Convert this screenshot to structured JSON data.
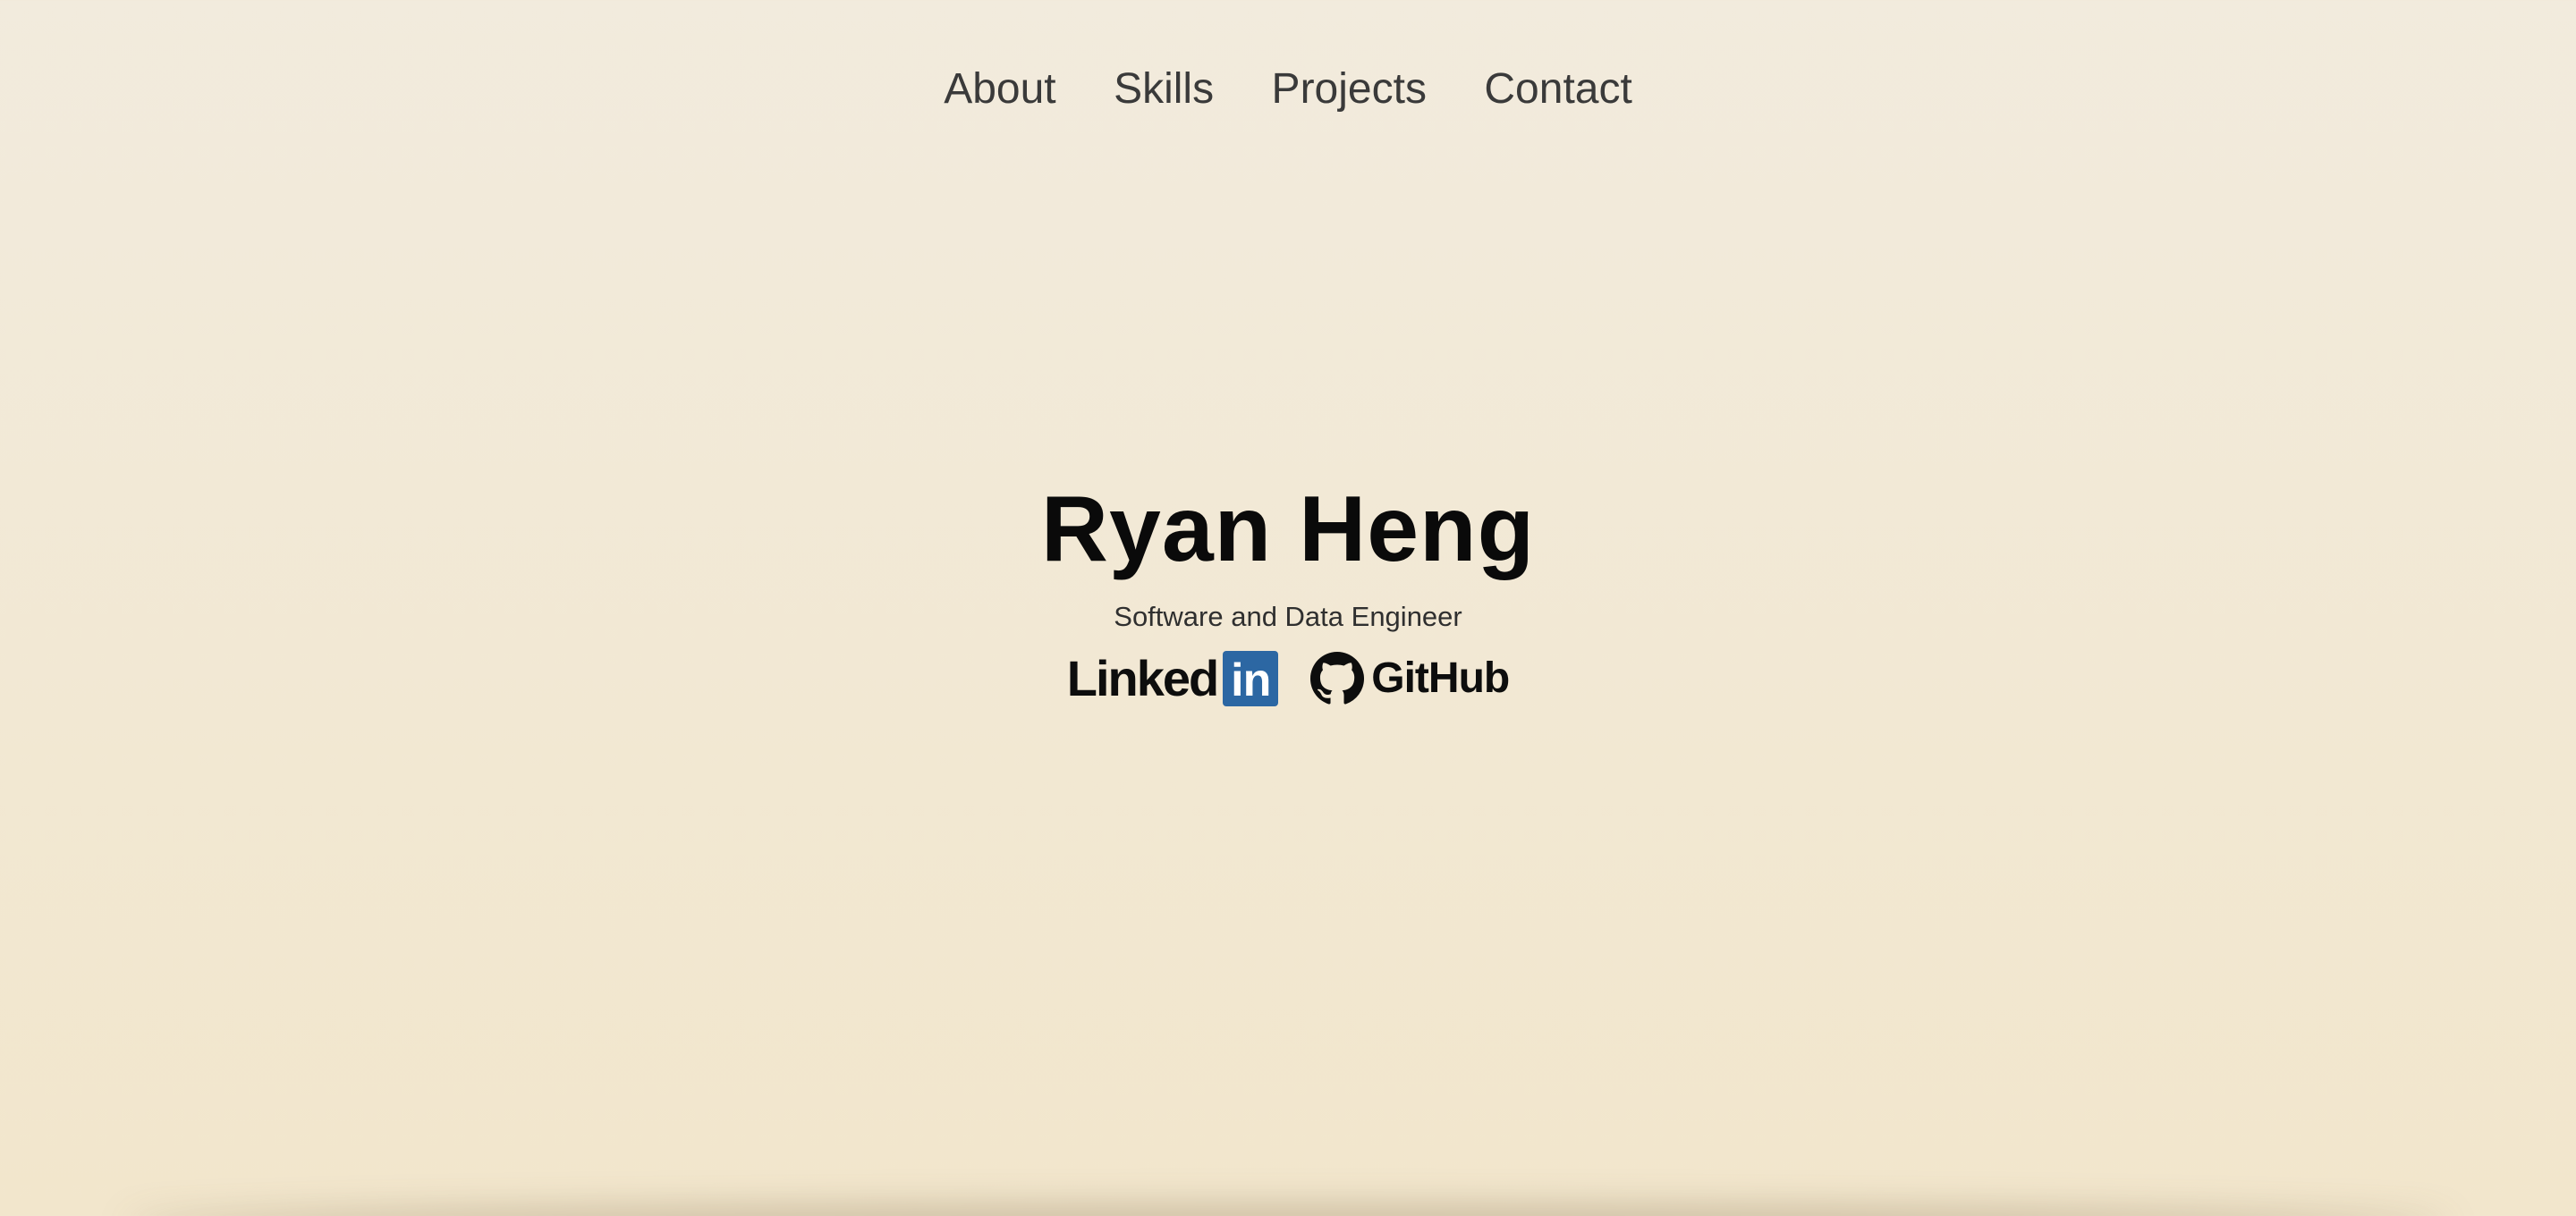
{
  "nav": {
    "items": [
      {
        "label": "About"
      },
      {
        "label": "Skills"
      },
      {
        "label": "Projects"
      },
      {
        "label": "Contact"
      }
    ]
  },
  "hero": {
    "name": "Ryan Heng",
    "subtitle": "Software and Data Engineer"
  },
  "socials": {
    "linkedin": {
      "word": "Linked",
      "badge": "in",
      "icon": "linkedin-icon"
    },
    "github": {
      "word": "GitHub",
      "icon": "github-icon"
    }
  },
  "colors": {
    "background_top": "#f2ebdd",
    "background_bottom": "#f2e6cc",
    "nav_text": "#3a3a3a",
    "name_text": "#0a0a0a",
    "linkedin_blue": "#2c67a3"
  }
}
